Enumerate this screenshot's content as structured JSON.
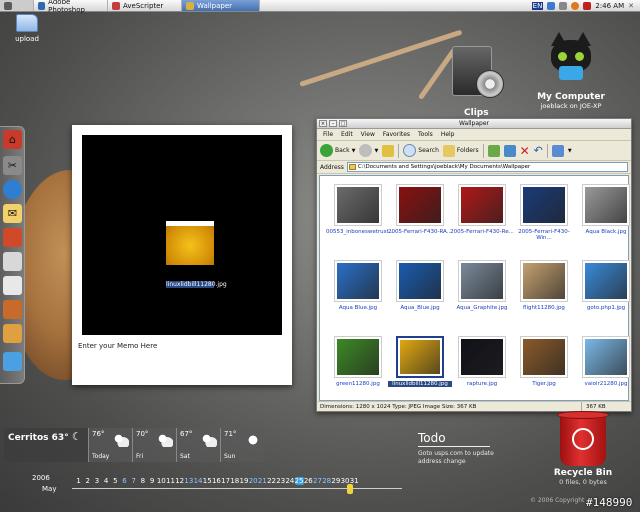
{
  "taskbar": {
    "tasks": [
      {
        "label": "Adobe Photoshop",
        "color": "#2b6cb0"
      },
      {
        "label": "AveScripter",
        "color": "#c04040"
      },
      {
        "label": "Wallpaper",
        "color": "#d8b040",
        "active": true
      }
    ],
    "lang": "EN",
    "time": "2:46 AM"
  },
  "desktop": {
    "upload_label": "upload",
    "clips_label": "Clips",
    "my_computer": {
      "title": "My Computer",
      "subtitle": "joeblack on JOE-XP"
    }
  },
  "memo": {
    "image_label": "linuxlidbill11280.jpg",
    "text": "Enter your Memo Here"
  },
  "explorer": {
    "title": "Wallpaper",
    "menu": [
      "File",
      "Edit",
      "View",
      "Favorites",
      "Tools",
      "Help"
    ],
    "toolbar": {
      "back": "Back",
      "search": "Search",
      "folders": "Folders"
    },
    "address_label": "Address",
    "address_value": "C:\\Documents and Settings\\joeblack\\My Documents\\Wallpaper",
    "files": [
      {
        "name": "00553_inboneswetrust...",
        "color": "#6b6b6b"
      },
      {
        "name": "2005-Ferrari-F430-RA...",
        "color": "#8a1010"
      },
      {
        "name": "2005-Ferrari-F430-Re...",
        "color": "#b01818"
      },
      {
        "name": "2005-Ferrari-F430-Win...",
        "color": "#1a3b7a"
      },
      {
        "name": "Aqua Black.jpg",
        "color": "#9a9a9a"
      },
      {
        "name": "Aqua Blue.jpg",
        "color": "#2a6fc8"
      },
      {
        "name": "Aqua_Blue.jpg",
        "color": "#1a5cb0"
      },
      {
        "name": "Aqua_Graphite.jpg",
        "color": "#7a8a9a"
      },
      {
        "name": "flight11280.jpg",
        "color": "#c4a070"
      },
      {
        "name": "goto.php1.jpg",
        "color": "#3a8ad8"
      },
      {
        "name": "green11280.jpg",
        "color": "#3c8a24"
      },
      {
        "name": "linuxlidbill11280.jpg",
        "color": "#e0a810",
        "selected": true
      },
      {
        "name": "rapture.jpg",
        "color": "#101018"
      },
      {
        "name": "Tiger.jpg",
        "color": "#8a5a2a"
      },
      {
        "name": "vaiolr21280.jpg",
        "color": "#7ab8e8"
      }
    ],
    "status_left": "Dimensions: 1280 x 1024 Type: JPEG Image Size: 367 KB",
    "status_right": "367 KB"
  },
  "weather": {
    "city": "Cerritos",
    "current": "63°",
    "days": [
      {
        "temp": "76°",
        "name": "Today"
      },
      {
        "temp": "70°",
        "name": "Fri"
      },
      {
        "temp": "67°",
        "name": "Sat"
      },
      {
        "temp": "71°",
        "name": "Sun"
      }
    ]
  },
  "calendar": {
    "year": "2006",
    "month": "May",
    "days": [
      "1",
      "2",
      "3",
      "4",
      "5",
      "6",
      "7",
      "8",
      "9",
      "10",
      "11",
      "12",
      "13",
      "14",
      "15",
      "16",
      "17",
      "18",
      "19",
      "20",
      "21",
      "22",
      "23",
      "24",
      "25",
      "26",
      "27",
      "28",
      "29",
      "30",
      "31"
    ]
  },
  "todo": {
    "title": "Todo",
    "note": "Goto usps.com to update address change"
  },
  "recycle_bin": {
    "title": "Recycle Bin",
    "subtitle": "0 files, 0 bytes"
  },
  "watermark": "#148990",
  "watermark_small": "© 2006 Copyright"
}
